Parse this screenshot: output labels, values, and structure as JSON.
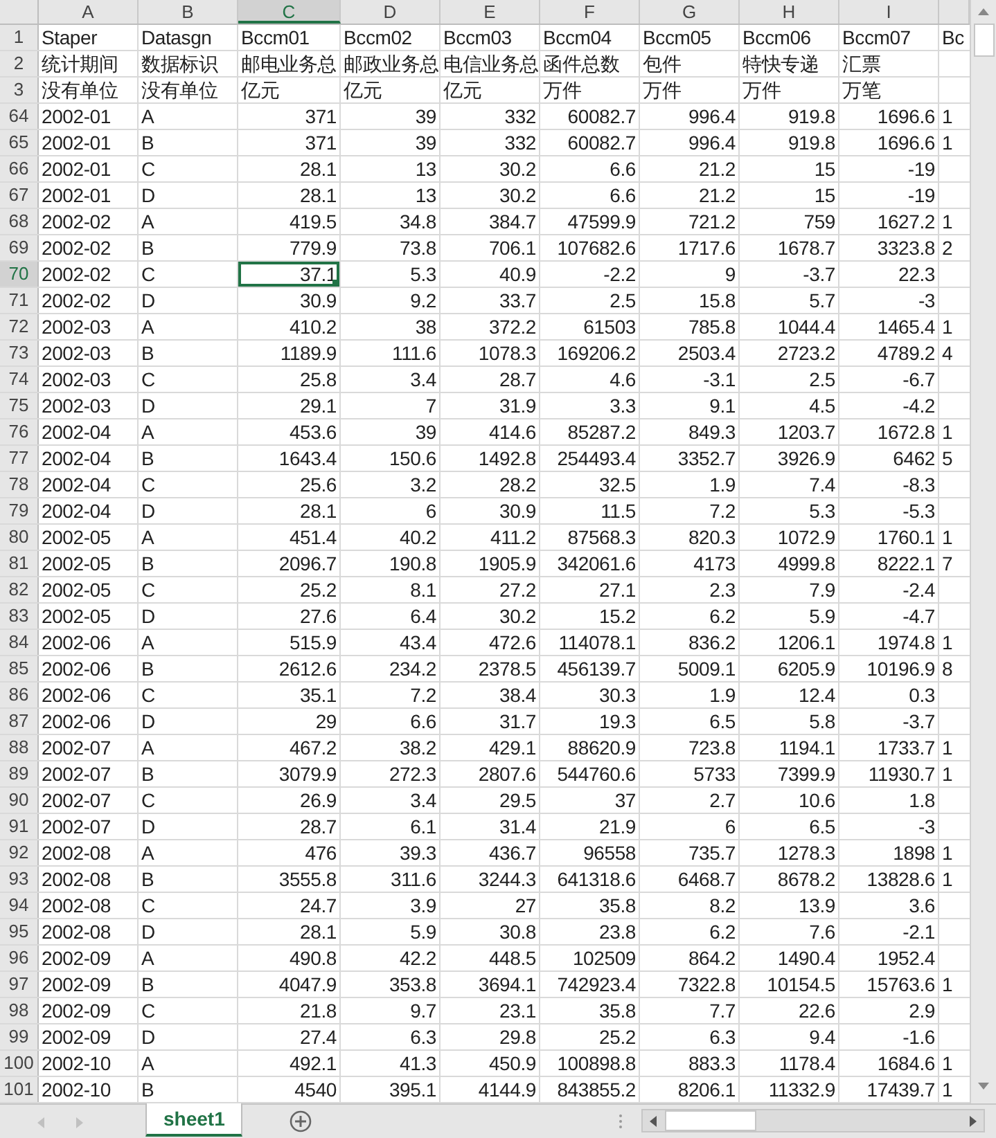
{
  "columns": [
    {
      "label": "A",
      "selected": false
    },
    {
      "label": "B",
      "selected": false
    },
    {
      "label": "C",
      "selected": true
    },
    {
      "label": "D",
      "selected": false
    },
    {
      "label": "E",
      "selected": false
    },
    {
      "label": "F",
      "selected": false
    },
    {
      "label": "G",
      "selected": false
    },
    {
      "label": "H",
      "selected": false
    },
    {
      "label": "I",
      "selected": false
    }
  ],
  "rows": [
    {
      "number": "1",
      "selected": false,
      "cells": [
        "Staper",
        "Datasgn",
        "Bccm01",
        "Bccm02",
        "Bccm03",
        "Bccm04",
        "Bccm05",
        "Bccm06",
        "Bccm07",
        "Bc"
      ]
    },
    {
      "number": "2",
      "selected": false,
      "cells": [
        "统计期间",
        "数据标识",
        "邮电业务总",
        "邮政业务总",
        "电信业务总",
        "函件总数",
        "包件",
        "特快专递",
        "汇票"
      ]
    },
    {
      "number": "3",
      "selected": false,
      "cells": [
        "没有单位",
        "没有单位",
        "亿元",
        "亿元",
        "亿元",
        "万件",
        "万件",
        "万件",
        "万笔"
      ]
    },
    {
      "number": "64",
      "selected": false,
      "cells": [
        "2002-01",
        "A",
        "371",
        "39",
        "332",
        "60082.7",
        "996.4",
        "919.8",
        "1696.6",
        "1"
      ]
    },
    {
      "number": "65",
      "selected": false,
      "cells": [
        "2002-01",
        "B",
        "371",
        "39",
        "332",
        "60082.7",
        "996.4",
        "919.8",
        "1696.6",
        "1"
      ]
    },
    {
      "number": "66",
      "selected": false,
      "cells": [
        "2002-01",
        "C",
        "28.1",
        "13",
        "30.2",
        "6.6",
        "21.2",
        "15",
        "-19"
      ]
    },
    {
      "number": "67",
      "selected": false,
      "cells": [
        "2002-01",
        "D",
        "28.1",
        "13",
        "30.2",
        "6.6",
        "21.2",
        "15",
        "-19"
      ]
    },
    {
      "number": "68",
      "selected": false,
      "cells": [
        "2002-02",
        "A",
        "419.5",
        "34.8",
        "384.7",
        "47599.9",
        "721.2",
        "759",
        "1627.2",
        "1"
      ]
    },
    {
      "number": "69",
      "selected": false,
      "cells": [
        "2002-02",
        "B",
        "779.9",
        "73.8",
        "706.1",
        "107682.6",
        "1717.6",
        "1678.7",
        "3323.8",
        "2"
      ]
    },
    {
      "number": "70",
      "selected": true,
      "cells": [
        "2002-02",
        "C",
        "37.1",
        "5.3",
        "40.9",
        "-2.2",
        "9",
        "-3.7",
        "22.3"
      ]
    },
    {
      "number": "71",
      "selected": false,
      "cells": [
        "2002-02",
        "D",
        "30.9",
        "9.2",
        "33.7",
        "2.5",
        "15.8",
        "5.7",
        "-3"
      ]
    },
    {
      "number": "72",
      "selected": false,
      "cells": [
        "2002-03",
        "A",
        "410.2",
        "38",
        "372.2",
        "61503",
        "785.8",
        "1044.4",
        "1465.4",
        "1"
      ]
    },
    {
      "number": "73",
      "selected": false,
      "cells": [
        "2002-03",
        "B",
        "1189.9",
        "111.6",
        "1078.3",
        "169206.2",
        "2503.4",
        "2723.2",
        "4789.2",
        "4"
      ]
    },
    {
      "number": "74",
      "selected": false,
      "cells": [
        "2002-03",
        "C",
        "25.8",
        "3.4",
        "28.7",
        "4.6",
        "-3.1",
        "2.5",
        "-6.7"
      ]
    },
    {
      "number": "75",
      "selected": false,
      "cells": [
        "2002-03",
        "D",
        "29.1",
        "7",
        "31.9",
        "3.3",
        "9.1",
        "4.5",
        "-4.2"
      ]
    },
    {
      "number": "76",
      "selected": false,
      "cells": [
        "2002-04",
        "A",
        "453.6",
        "39",
        "414.6",
        "85287.2",
        "849.3",
        "1203.7",
        "1672.8",
        "1"
      ]
    },
    {
      "number": "77",
      "selected": false,
      "cells": [
        "2002-04",
        "B",
        "1643.4",
        "150.6",
        "1492.8",
        "254493.4",
        "3352.7",
        "3926.9",
        "6462",
        "5"
      ]
    },
    {
      "number": "78",
      "selected": false,
      "cells": [
        "2002-04",
        "C",
        "25.6",
        "3.2",
        "28.2",
        "32.5",
        "1.9",
        "7.4",
        "-8.3"
      ]
    },
    {
      "number": "79",
      "selected": false,
      "cells": [
        "2002-04",
        "D",
        "28.1",
        "6",
        "30.9",
        "11.5",
        "7.2",
        "5.3",
        "-5.3"
      ]
    },
    {
      "number": "80",
      "selected": false,
      "cells": [
        "2002-05",
        "A",
        "451.4",
        "40.2",
        "411.2",
        "87568.3",
        "820.3",
        "1072.9",
        "1760.1",
        "1"
      ]
    },
    {
      "number": "81",
      "selected": false,
      "cells": [
        "2002-05",
        "B",
        "2096.7",
        "190.8",
        "1905.9",
        "342061.6",
        "4173",
        "4999.8",
        "8222.1",
        "7"
      ]
    },
    {
      "number": "82",
      "selected": false,
      "cells": [
        "2002-05",
        "C",
        "25.2",
        "8.1",
        "27.2",
        "27.1",
        "2.3",
        "7.9",
        "-2.4"
      ]
    },
    {
      "number": "83",
      "selected": false,
      "cells": [
        "2002-05",
        "D",
        "27.6",
        "6.4",
        "30.2",
        "15.2",
        "6.2",
        "5.9",
        "-4.7"
      ]
    },
    {
      "number": "84",
      "selected": false,
      "cells": [
        "2002-06",
        "A",
        "515.9",
        "43.4",
        "472.6",
        "114078.1",
        "836.2",
        "1206.1",
        "1974.8",
        "1"
      ]
    },
    {
      "number": "85",
      "selected": false,
      "cells": [
        "2002-06",
        "B",
        "2612.6",
        "234.2",
        "2378.5",
        "456139.7",
        "5009.1",
        "6205.9",
        "10196.9",
        "8"
      ]
    },
    {
      "number": "86",
      "selected": false,
      "cells": [
        "2002-06",
        "C",
        "35.1",
        "7.2",
        "38.4",
        "30.3",
        "1.9",
        "12.4",
        "0.3"
      ]
    },
    {
      "number": "87",
      "selected": false,
      "cells": [
        "2002-06",
        "D",
        "29",
        "6.6",
        "31.7",
        "19.3",
        "6.5",
        "5.8",
        "-3.7"
      ]
    },
    {
      "number": "88",
      "selected": false,
      "cells": [
        "2002-07",
        "A",
        "467.2",
        "38.2",
        "429.1",
        "88620.9",
        "723.8",
        "1194.1",
        "1733.7",
        "1"
      ]
    },
    {
      "number": "89",
      "selected": false,
      "cells": [
        "2002-07",
        "B",
        "3079.9",
        "272.3",
        "2807.6",
        "544760.6",
        "5733",
        "7399.9",
        "11930.7",
        "1"
      ]
    },
    {
      "number": "90",
      "selected": false,
      "cells": [
        "2002-07",
        "C",
        "26.9",
        "3.4",
        "29.5",
        "37",
        "2.7",
        "10.6",
        "1.8"
      ]
    },
    {
      "number": "91",
      "selected": false,
      "cells": [
        "2002-07",
        "D",
        "28.7",
        "6.1",
        "31.4",
        "21.9",
        "6",
        "6.5",
        "-3"
      ]
    },
    {
      "number": "92",
      "selected": false,
      "cells": [
        "2002-08",
        "A",
        "476",
        "39.3",
        "436.7",
        "96558",
        "735.7",
        "1278.3",
        "1898",
        "1"
      ]
    },
    {
      "number": "93",
      "selected": false,
      "cells": [
        "2002-08",
        "B",
        "3555.8",
        "311.6",
        "3244.3",
        "641318.6",
        "6468.7",
        "8678.2",
        "13828.6",
        "1"
      ]
    },
    {
      "number": "94",
      "selected": false,
      "cells": [
        "2002-08",
        "C",
        "24.7",
        "3.9",
        "27",
        "35.8",
        "8.2",
        "13.9",
        "3.6"
      ]
    },
    {
      "number": "95",
      "selected": false,
      "cells": [
        "2002-08",
        "D",
        "28.1",
        "5.9",
        "30.8",
        "23.8",
        "6.2",
        "7.6",
        "-2.1"
      ]
    },
    {
      "number": "96",
      "selected": false,
      "cells": [
        "2002-09",
        "A",
        "490.8",
        "42.2",
        "448.5",
        "102509",
        "864.2",
        "1490.4",
        "1952.4"
      ]
    },
    {
      "number": "97",
      "selected": false,
      "cells": [
        "2002-09",
        "B",
        "4047.9",
        "353.8",
        "3694.1",
        "742923.4",
        "7322.8",
        "10154.5",
        "15763.6",
        "1"
      ]
    },
    {
      "number": "98",
      "selected": false,
      "cells": [
        "2002-09",
        "C",
        "21.8",
        "9.7",
        "23.1",
        "35.8",
        "7.7",
        "22.6",
        "2.9"
      ]
    },
    {
      "number": "99",
      "selected": false,
      "cells": [
        "2002-09",
        "D",
        "27.4",
        "6.3",
        "29.8",
        "25.2",
        "6.3",
        "9.4",
        "-1.6"
      ]
    },
    {
      "number": "100",
      "selected": false,
      "cells": [
        "2002-10",
        "A",
        "492.1",
        "41.3",
        "450.9",
        "100898.8",
        "883.3",
        "1178.4",
        "1684.6",
        "1"
      ]
    },
    {
      "number": "101",
      "selected": false,
      "cells": [
        "2002-10",
        "B",
        "4540",
        "395.1",
        "4144.9",
        "843855.2",
        "8206.1",
        "11332.9",
        "17439.7",
        "1"
      ]
    }
  ],
  "sheet_tabs": [
    {
      "label": "sheet1",
      "selected": true
    }
  ]
}
